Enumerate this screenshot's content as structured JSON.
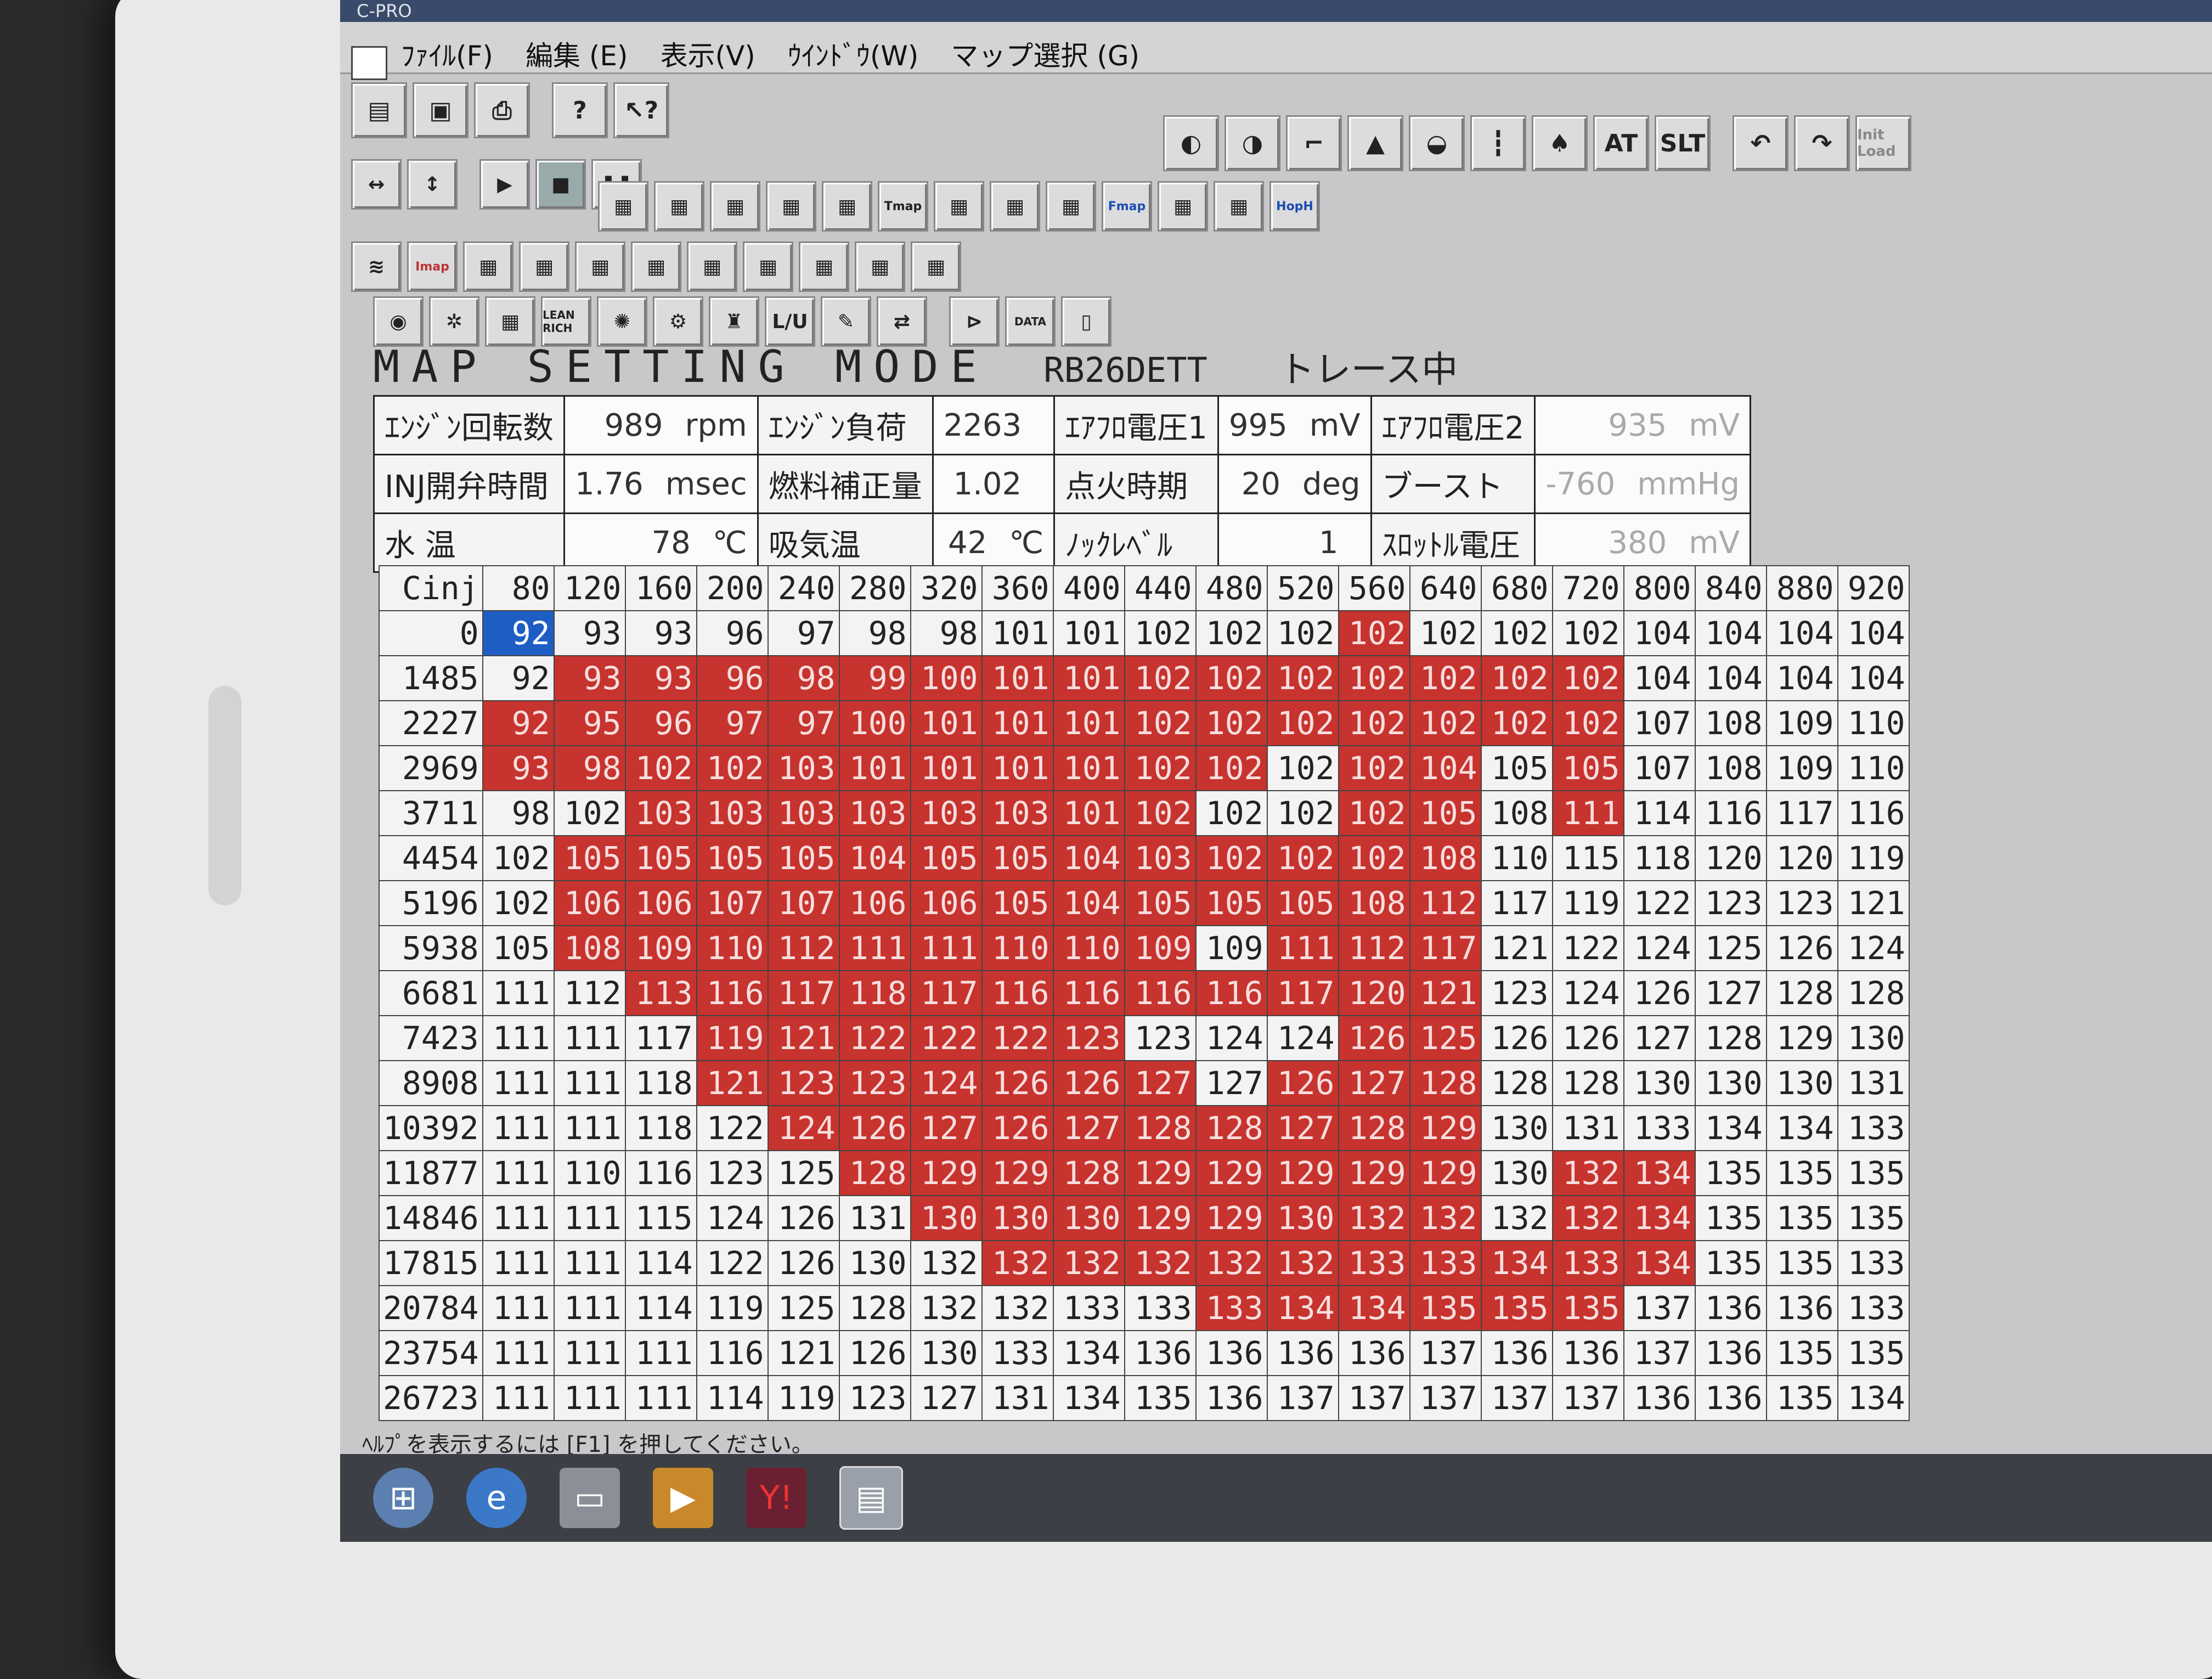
{
  "window": {
    "title": "C-PRO"
  },
  "menu": [
    {
      "label": "ﾌｧｲﾙ(F)"
    },
    {
      "label": "編集 (E)"
    },
    {
      "label": "表示(V)"
    },
    {
      "label": "ｳｲﾝﾄﾞｳ(W)"
    },
    {
      "label": "マップ選択 (G)"
    }
  ],
  "toolbar_text": {
    "tmap": "Tmap",
    "fmap": "Fmap",
    "hmap": "HopH",
    "slt": "SLT",
    "init": "Init Load",
    "lu": "L/U",
    "lean": "LEAN RICH",
    "data": "DATA"
  },
  "mode": {
    "title": "MAP SETTING MODE",
    "engine": "RB26DETT",
    "status": "トレース中"
  },
  "params": {
    "rows": [
      [
        {
          "label": "ｴﾝｼﾞﾝ回転数",
          "value": "989",
          "unit": "rpm"
        },
        {
          "label": "ｴﾝｼﾞﾝ負荷",
          "value": "2263",
          "unit": ""
        },
        {
          "label": "ｴｱﾌﾛ電圧1",
          "value": "995",
          "unit": "mV"
        },
        {
          "label": "ｴｱﾌﾛ電圧2",
          "value": "935",
          "unit": "mV"
        }
      ],
      [
        {
          "label": "INJ開弁時間",
          "value": "1.76",
          "unit": "msec"
        },
        {
          "label": "燃料補正量",
          "value": "1.02",
          "unit": ""
        },
        {
          "label": "点火時期",
          "value": "20",
          "unit": "deg"
        },
        {
          "label": "ブースト",
          "value": "-760",
          "unit": "mmHg"
        }
      ],
      [
        {
          "label": "水 温",
          "value": "78",
          "unit": "℃"
        },
        {
          "label": "吸気温",
          "value": "42",
          "unit": "℃"
        },
        {
          "label": "ﾉｯｸﾚﾍﾞﾙ",
          "value": "1",
          "unit": ""
        },
        {
          "label": "ｽﾛｯﾄﾙ電圧",
          "value": "380",
          "unit": "mV"
        }
      ]
    ]
  },
  "map": {
    "corner": "Cinj",
    "columns": [
      "80",
      "120",
      "160",
      "200",
      "240",
      "280",
      "320",
      "360",
      "400",
      "440",
      "480",
      "520",
      "560",
      "640",
      "680",
      "720",
      "800",
      "840",
      "880",
      "920"
    ],
    "rows": [
      {
        "rpm": "0",
        "cells": [
          "92",
          "93",
          "93",
          "96",
          "97",
          "98",
          "98",
          "101",
          "101",
          "102",
          "102",
          "102",
          "102",
          "102",
          "102",
          "102",
          "104",
          "104",
          "104",
          "104"
        ]
      },
      {
        "rpm": "1485",
        "cells": [
          "92",
          "93",
          "93",
          "96",
          "98",
          "99",
          "100",
          "101",
          "101",
          "102",
          "102",
          "102",
          "102",
          "102",
          "102",
          "102",
          "104",
          "104",
          "104",
          "104"
        ]
      },
      {
        "rpm": "2227",
        "cells": [
          "92",
          "95",
          "96",
          "97",
          "97",
          "100",
          "101",
          "101",
          "101",
          "102",
          "102",
          "102",
          "102",
          "102",
          "102",
          "102",
          "107",
          "108",
          "109",
          "110"
        ]
      },
      {
        "rpm": "2969",
        "cells": [
          "93",
          "98",
          "102",
          "102",
          "103",
          "101",
          "101",
          "101",
          "101",
          "102",
          "102",
          "102",
          "102",
          "104",
          "105",
          "105",
          "107",
          "108",
          "109",
          "110"
        ]
      },
      {
        "rpm": "3711",
        "cells": [
          "98",
          "102",
          "103",
          "103",
          "103",
          "103",
          "103",
          "103",
          "101",
          "102",
          "102",
          "102",
          "102",
          "105",
          "108",
          "111",
          "114",
          "116",
          "117",
          "116"
        ]
      },
      {
        "rpm": "4454",
        "cells": [
          "102",
          "105",
          "105",
          "105",
          "105",
          "104",
          "105",
          "105",
          "104",
          "103",
          "102",
          "102",
          "102",
          "108",
          "110",
          "115",
          "118",
          "120",
          "120",
          "119"
        ]
      },
      {
        "rpm": "5196",
        "cells": [
          "102",
          "106",
          "106",
          "107",
          "107",
          "106",
          "106",
          "105",
          "104",
          "105",
          "105",
          "105",
          "108",
          "112",
          "117",
          "119",
          "122",
          "123",
          "123",
          "121"
        ]
      },
      {
        "rpm": "5938",
        "cells": [
          "105",
          "108",
          "109",
          "110",
          "112",
          "111",
          "111",
          "110",
          "110",
          "109",
          "109",
          "111",
          "112",
          "117",
          "121",
          "122",
          "124",
          "125",
          "126",
          "124"
        ]
      },
      {
        "rpm": "6681",
        "cells": [
          "111",
          "112",
          "113",
          "116",
          "117",
          "118",
          "117",
          "116",
          "116",
          "116",
          "116",
          "117",
          "120",
          "121",
          "123",
          "124",
          "126",
          "127",
          "128",
          "128"
        ]
      },
      {
        "rpm": "7423",
        "cells": [
          "111",
          "111",
          "117",
          "119",
          "121",
          "122",
          "122",
          "122",
          "123",
          "123",
          "124",
          "124",
          "126",
          "125",
          "126",
          "126",
          "127",
          "128",
          "129",
          "130"
        ]
      },
      {
        "rpm": "8908",
        "cells": [
          "111",
          "111",
          "118",
          "121",
          "123",
          "123",
          "124",
          "126",
          "126",
          "127",
          "127",
          "126",
          "127",
          "128",
          "128",
          "128",
          "130",
          "130",
          "130",
          "131"
        ]
      },
      {
        "rpm": "10392",
        "cells": [
          "111",
          "111",
          "118",
          "122",
          "124",
          "126",
          "127",
          "126",
          "127",
          "128",
          "128",
          "127",
          "128",
          "129",
          "130",
          "131",
          "133",
          "134",
          "134",
          "133"
        ]
      },
      {
        "rpm": "11877",
        "cells": [
          "111",
          "110",
          "116",
          "123",
          "125",
          "128",
          "129",
          "129",
          "128",
          "129",
          "129",
          "129",
          "129",
          "129",
          "130",
          "132",
          "134",
          "135",
          "135",
          "135"
        ]
      },
      {
        "rpm": "14846",
        "cells": [
          "111",
          "111",
          "115",
          "124",
          "126",
          "131",
          "130",
          "130",
          "130",
          "129",
          "129",
          "130",
          "132",
          "132",
          "132",
          "132",
          "134",
          "135",
          "135",
          "135"
        ]
      },
      {
        "rpm": "17815",
        "cells": [
          "111",
          "111",
          "114",
          "122",
          "126",
          "130",
          "132",
          "132",
          "132",
          "132",
          "132",
          "132",
          "133",
          "133",
          "134",
          "133",
          "134",
          "135",
          "135",
          "133"
        ]
      },
      {
        "rpm": "20784",
        "cells": [
          "111",
          "111",
          "114",
          "119",
          "125",
          "128",
          "132",
          "132",
          "133",
          "133",
          "133",
          "134",
          "134",
          "135",
          "135",
          "135",
          "137",
          "136",
          "136",
          "133"
        ]
      },
      {
        "rpm": "23754",
        "cells": [
          "111",
          "111",
          "111",
          "116",
          "121",
          "126",
          "130",
          "133",
          "134",
          "136",
          "136",
          "136",
          "136",
          "137",
          "136",
          "136",
          "137",
          "136",
          "135",
          "135"
        ]
      },
      {
        "rpm": "26723",
        "cells": [
          "111",
          "111",
          "111",
          "114",
          "119",
          "123",
          "127",
          "131",
          "134",
          "135",
          "136",
          "137",
          "137",
          "137",
          "137",
          "137",
          "136",
          "136",
          "135",
          "134"
        ]
      }
    ],
    "highlight_note": "red = traced cells",
    "red_mask": [
      [
        0,
        0,
        0,
        0,
        0,
        0,
        0,
        0,
        0,
        0,
        0,
        0,
        1,
        0,
        0,
        0,
        0,
        0,
        0,
        0
      ],
      [
        0,
        1,
        1,
        1,
        1,
        1,
        1,
        1,
        1,
        1,
        1,
        1,
        1,
        1,
        1,
        1,
        0,
        0,
        0,
        0
      ],
      [
        1,
        1,
        1,
        1,
        1,
        1,
        1,
        1,
        1,
        1,
        1,
        1,
        1,
        1,
        1,
        1,
        0,
        0,
        0,
        0
      ],
      [
        1,
        1,
        1,
        1,
        1,
        1,
        1,
        1,
        1,
        1,
        1,
        0,
        1,
        1,
        0,
        1,
        0,
        0,
        0,
        0
      ],
      [
        0,
        0,
        1,
        1,
        1,
        1,
        1,
        1,
        1,
        1,
        0,
        0,
        1,
        1,
        0,
        1,
        0,
        0,
        0,
        0
      ],
      [
        0,
        1,
        1,
        1,
        1,
        1,
        1,
        1,
        1,
        1,
        1,
        1,
        1,
        1,
        0,
        0,
        0,
        0,
        0,
        0
      ],
      [
        0,
        1,
        1,
        1,
        1,
        1,
        1,
        1,
        1,
        1,
        1,
        1,
        1,
        1,
        0,
        0,
        0,
        0,
        0,
        0
      ],
      [
        0,
        1,
        1,
        1,
        1,
        1,
        1,
        1,
        1,
        1,
        0,
        1,
        1,
        1,
        0,
        0,
        0,
        0,
        0,
        0
      ],
      [
        0,
        0,
        1,
        1,
        1,
        1,
        1,
        1,
        1,
        1,
        1,
        1,
        1,
        1,
        0,
        0,
        0,
        0,
        0,
        0
      ],
      [
        0,
        0,
        0,
        1,
        1,
        1,
        1,
        1,
        1,
        0,
        0,
        0,
        1,
        1,
        0,
        0,
        0,
        0,
        0,
        0
      ],
      [
        0,
        0,
        0,
        1,
        1,
        1,
        1,
        1,
        1,
        1,
        0,
        1,
        1,
        1,
        0,
        0,
        0,
        0,
        0,
        0
      ],
      [
        0,
        0,
        0,
        0,
        1,
        1,
        1,
        1,
        1,
        1,
        1,
        1,
        1,
        1,
        0,
        0,
        0,
        0,
        0,
        0
      ],
      [
        0,
        0,
        0,
        0,
        0,
        1,
        1,
        1,
        1,
        1,
        1,
        1,
        1,
        1,
        0,
        1,
        1,
        0,
        0,
        0
      ],
      [
        0,
        0,
        0,
        0,
        0,
        0,
        1,
        1,
        1,
        1,
        1,
        1,
        1,
        1,
        0,
        1,
        1,
        0,
        0,
        0
      ],
      [
        0,
        0,
        0,
        0,
        0,
        0,
        0,
        1,
        1,
        1,
        1,
        1,
        1,
        1,
        1,
        1,
        1,
        0,
        0,
        0
      ],
      [
        0,
        0,
        0,
        0,
        0,
        0,
        0,
        0,
        0,
        0,
        1,
        1,
        1,
        1,
        1,
        1,
        0,
        0,
        0,
        0
      ],
      [
        0,
        0,
        0,
        0,
        0,
        0,
        0,
        0,
        0,
        0,
        0,
        0,
        0,
        0,
        0,
        0,
        0,
        0,
        0,
        0
      ],
      [
        0,
        0,
        0,
        0,
        0,
        0,
        0,
        0,
        0,
        0,
        0,
        0,
        0,
        0,
        0,
        0,
        0,
        0,
        0,
        0
      ]
    ]
  },
  "status_bar": "ﾍﾙﾌﾟを表示するには [F1] を押してください。",
  "taskbar": {
    "items": [
      "start-icon",
      "ie-icon",
      "explorer-icon",
      "media-player-icon",
      "yahoo-icon",
      "app-window-icon"
    ],
    "yahoo_label": "Y!",
    "ie_label": "e"
  }
}
